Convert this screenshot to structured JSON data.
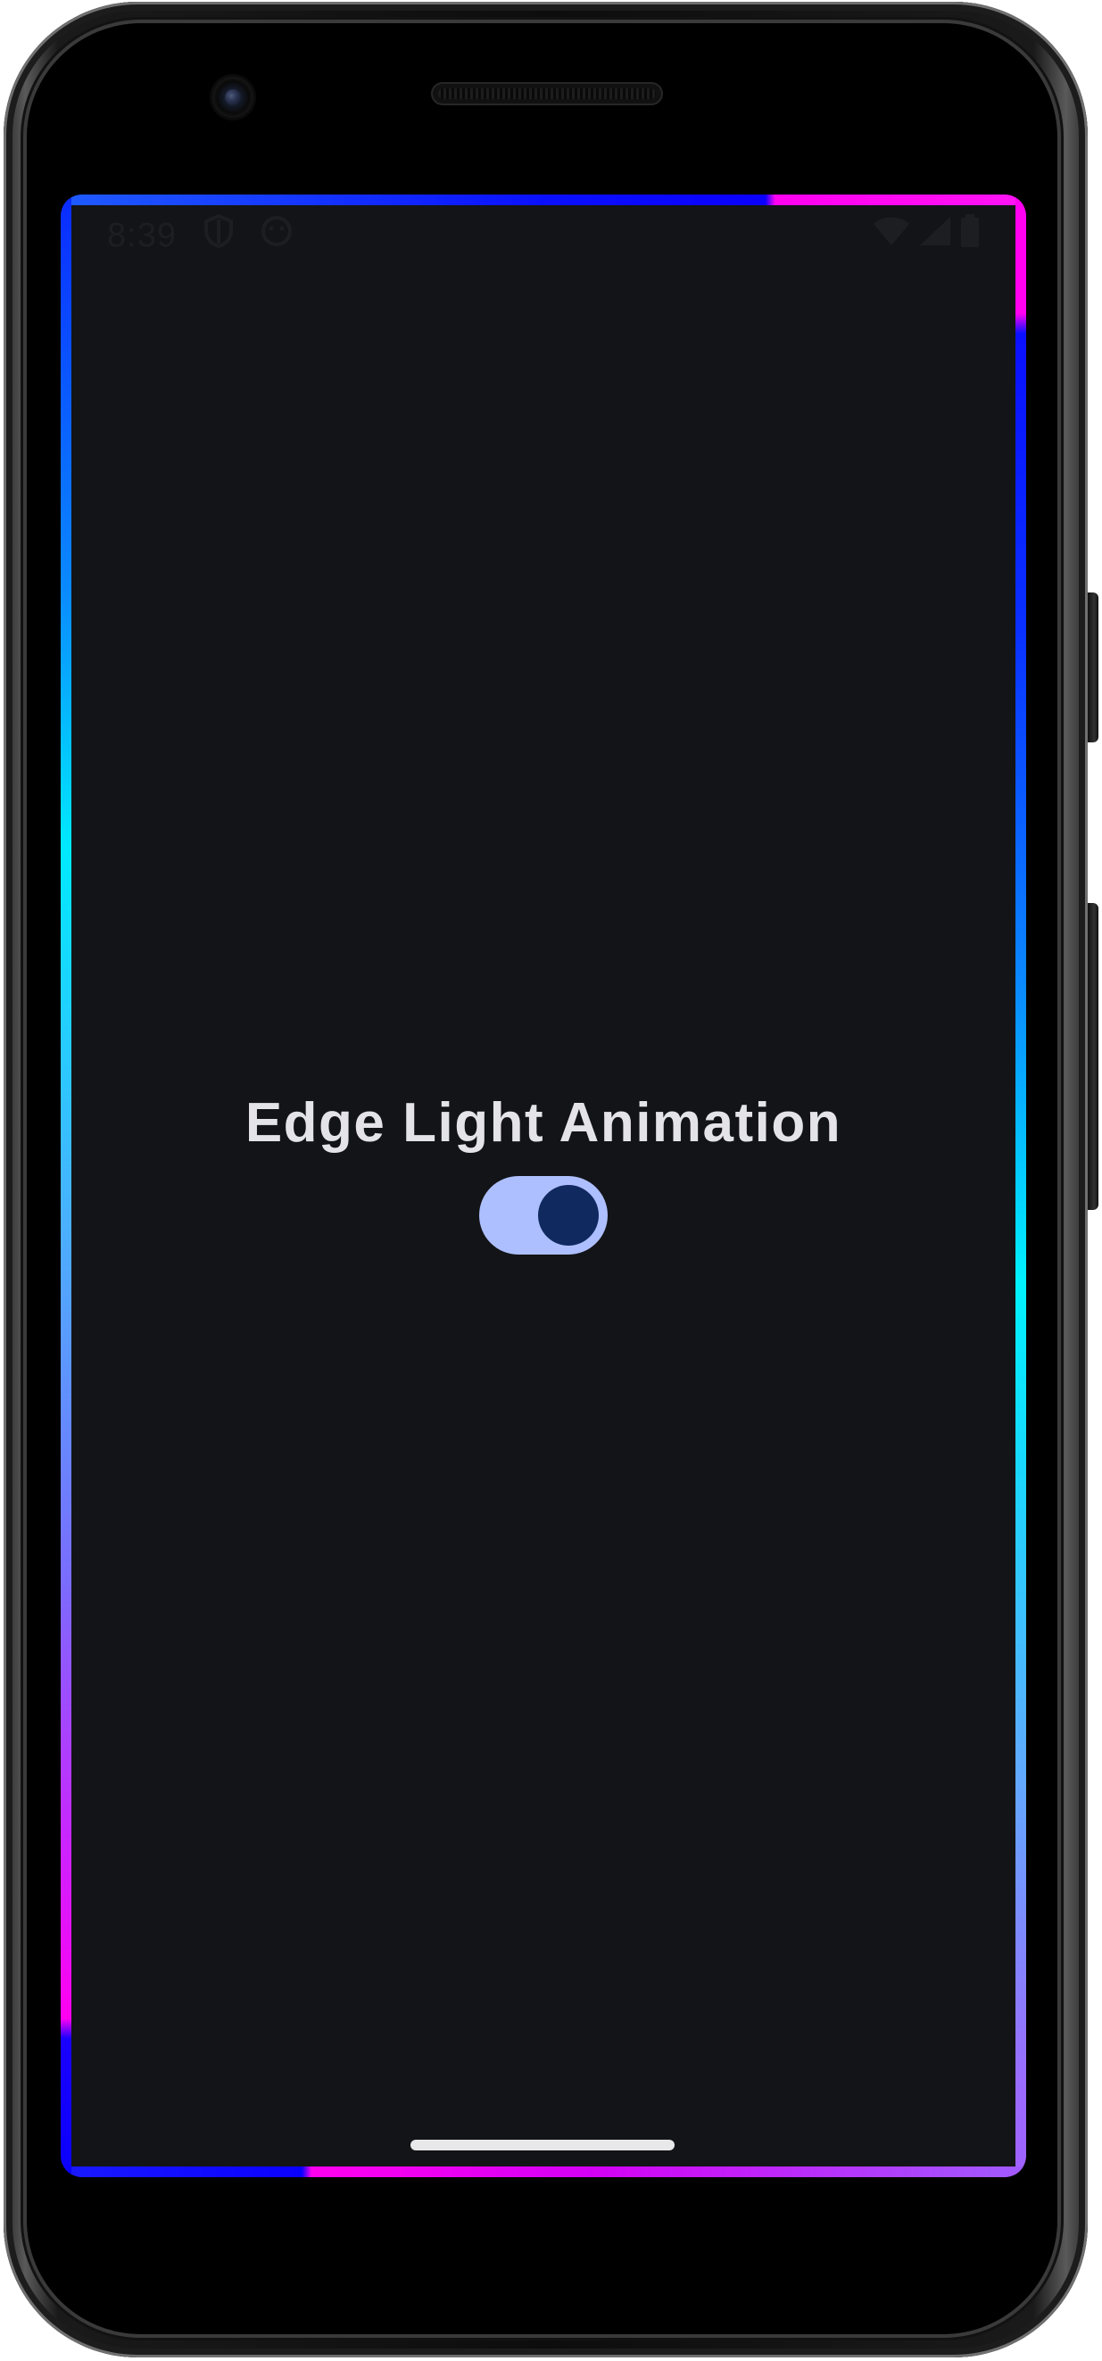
{
  "device": {
    "model": "phone-frame"
  },
  "status_bar": {
    "time": "8:39",
    "left_icons": [
      "shield-icon",
      "face-icon"
    ],
    "right_icons": [
      "wifi-icon",
      "signal-icon",
      "battery-icon"
    ]
  },
  "main": {
    "title": "Edge Light Animation",
    "toggle": {
      "state": "on",
      "track_color": "#aebfff",
      "thumb_color": "#102a60"
    }
  },
  "colors": {
    "background": "#131417",
    "title_text": "#e3e3e8",
    "edge_blue": "#0a00ff",
    "edge_magenta": "#ff00f0",
    "edge_cyan": "#00eaff",
    "edge_violet": "#a060ff"
  }
}
